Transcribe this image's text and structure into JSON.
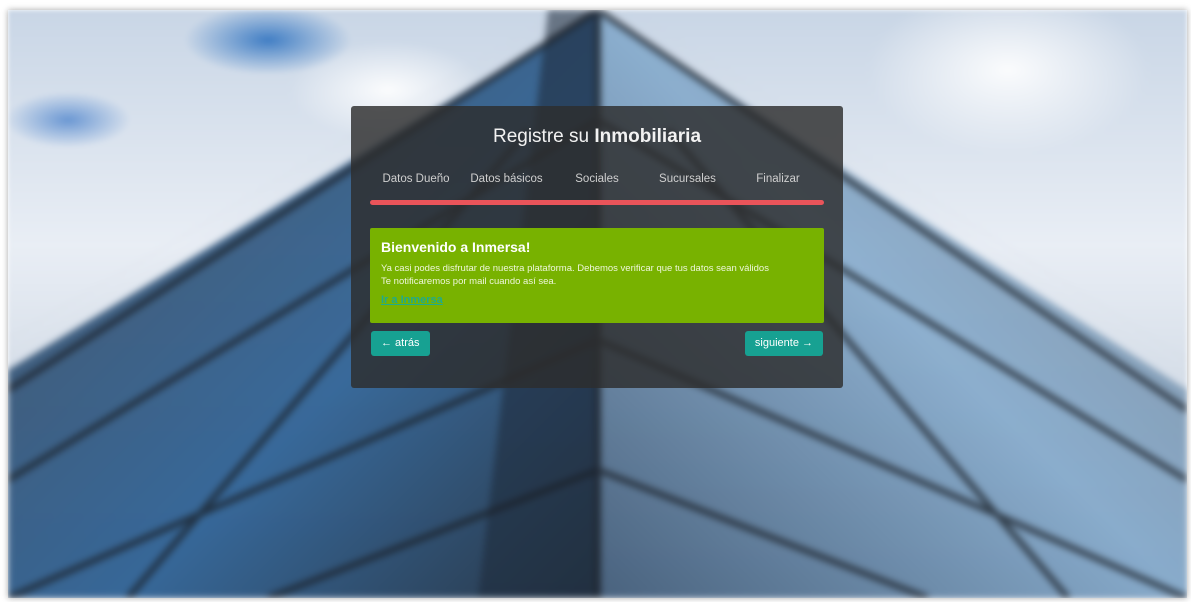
{
  "page": {
    "title_prefix": "Registre su",
    "title_emphasis": "Inmobiliaria"
  },
  "steps": [
    {
      "label": "Datos Dueño"
    },
    {
      "label": "Datos básicos"
    },
    {
      "label": "Sociales"
    },
    {
      "label": "Sucursales"
    },
    {
      "label": "Finalizar"
    }
  ],
  "progress": {
    "percent": 100,
    "color": "#e9545a"
  },
  "alert": {
    "title": "Bienvenido a Inmersa!",
    "line1": "Ya casi podes disfrutar de nuestra plataforma. Debemos verificar que tus datos sean válidos",
    "line2": "Te notificaremos por mail cuando así sea.",
    "link": "Ir a Inmersa",
    "color": "#78b200"
  },
  "buttons": {
    "back": "← atrás",
    "next": "siguiente →",
    "color": "#17a192"
  }
}
